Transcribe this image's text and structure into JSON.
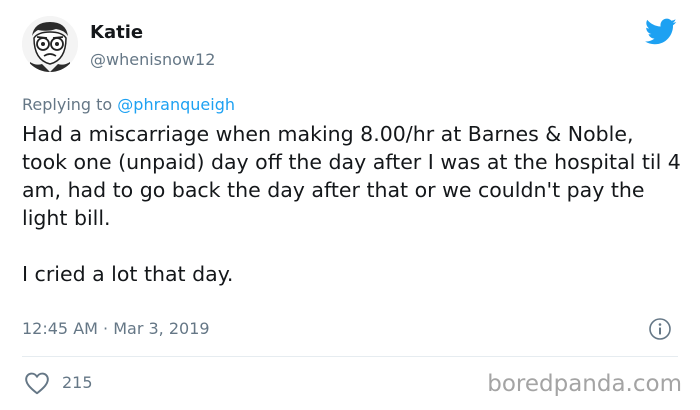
{
  "user": {
    "display_name": "Katie",
    "handle": "@whenisnow12",
    "avatar_icon": "cartoon-face-avatar"
  },
  "reply": {
    "prefix": "Replying to ",
    "to_handle": "@phranqueigh"
  },
  "tweet": {
    "paragraphs": [
      "Had a miscarriage when making 8.00/hr at Barnes & Noble, took one (unpaid) day off the day after I was at the hospital til 4 am, had to go back the day after that or we couldn't pay the light bill.",
      "I cried a lot that day."
    ],
    "timestamp": "12:45 AM · Mar 3, 2019"
  },
  "stats": {
    "likes": "215"
  },
  "watermark": "boredpanda.com",
  "colors": {
    "twitter_blue": "#1da1f2",
    "muted_text": "#657786",
    "main_text": "#14171a"
  },
  "icons": {
    "brand": "twitter-bird-icon",
    "info": "info-icon",
    "like": "heart-icon"
  }
}
